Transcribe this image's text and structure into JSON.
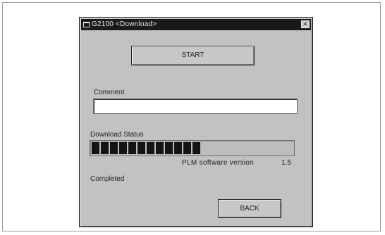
{
  "window": {
    "title": "G2100 <Download>",
    "close_label": "×",
    "icon": "app-window-icon"
  },
  "buttons": {
    "start_label": "START",
    "back_label": "BACK"
  },
  "comment": {
    "label": "Comment",
    "value": "",
    "placeholder": ""
  },
  "download": {
    "status_label": "Download Status",
    "progress_fraction": 0.53,
    "software_version_label": "PLM software version",
    "software_version": "1.5",
    "status_text": "Completed"
  },
  "colors": {
    "dialog_background": "#c2c2c2",
    "titlebar": "#1a1a1a",
    "progress_fill": "#141414"
  }
}
